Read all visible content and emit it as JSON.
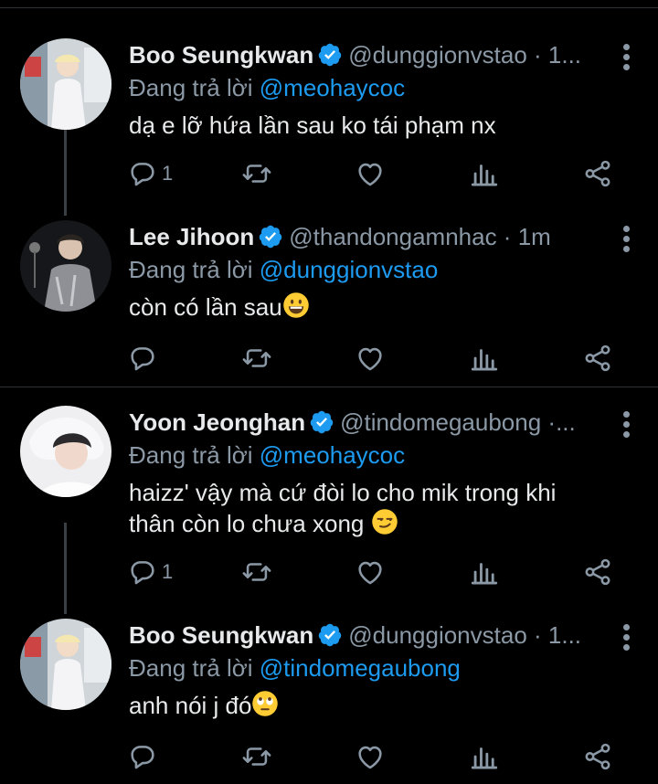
{
  "colors": {
    "background": "#000000",
    "text": "#e7e9ea",
    "muted": "#8b98a5",
    "link": "#1d9bf0",
    "verified": "#1d9bf0"
  },
  "tweets": [
    {
      "name": "Boo Seungkwan",
      "handle": "@dunggionvstao · 1...",
      "reply_prefix": "Đang trả lời ",
      "reply_to": "@meohaycoc",
      "text": "dạ e lỡ hứa lần sau ko tái phạm nx",
      "reply_count": "1",
      "emoji": ""
    },
    {
      "name": "Lee Jihoon",
      "handle": "@thandongamnhac · 1m",
      "reply_prefix": "Đang trả lời ",
      "reply_to": "@dunggionvstao",
      "text": "còn có lần sau",
      "reply_count": "",
      "emoji": "grinning-face"
    },
    {
      "name": "Yoon Jeonghan",
      "handle": "@tindomegaubong ·...",
      "reply_prefix": "Đang trả lời ",
      "reply_to": "@meohaycoc",
      "text": "haizz' vậy mà cứ đòi lo cho mik trong khi thân còn lo chưa xong",
      "reply_count": "1",
      "emoji": "smirking-face"
    },
    {
      "name": "Boo Seungkwan",
      "handle": "@dunggionvstao · 1...",
      "reply_prefix": "Đang trả lời ",
      "reply_to": "@tindomegaubong",
      "text": "anh nói j đó",
      "reply_count": "",
      "emoji": "eye-roll-face"
    }
  ],
  "icons": [
    "verified-badge-icon",
    "more-icon",
    "reply-icon",
    "retweet-icon",
    "like-icon",
    "analytics-icon",
    "share-icon"
  ]
}
